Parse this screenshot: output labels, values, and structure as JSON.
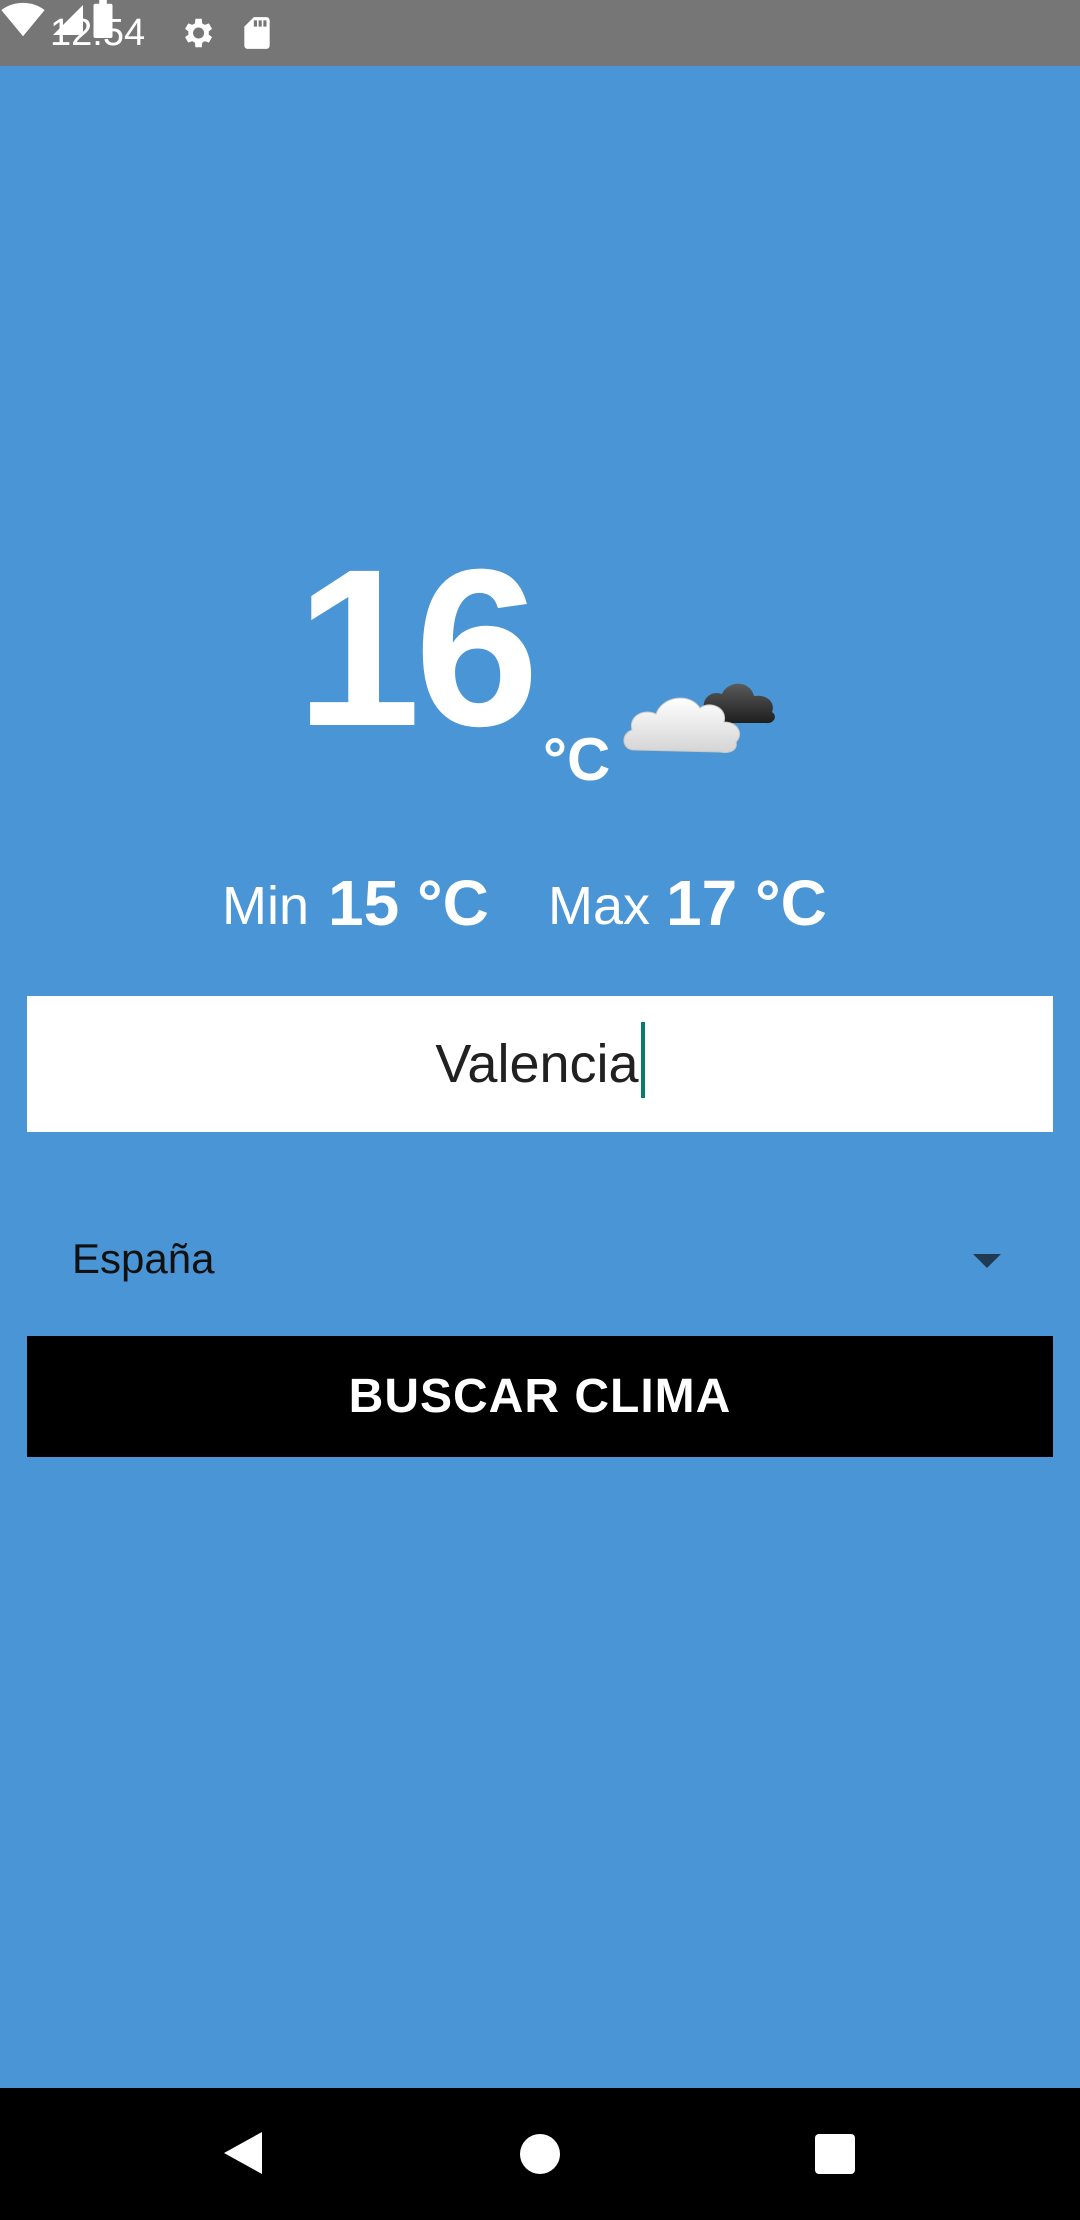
{
  "status_bar": {
    "time": "12:54",
    "icons": [
      "gear-icon",
      "sd-card-icon",
      "wifi-icon",
      "signal-icon",
      "battery-icon"
    ]
  },
  "weather": {
    "temperature": "16",
    "unit": "°C",
    "condition_icon": "partly-cloudy-icon",
    "min_label": "Min",
    "min_value": "15 °C",
    "max_label": "Max",
    "max_value": "17 °C"
  },
  "form": {
    "city_value": "Valencia",
    "country_value": "España",
    "button_label": "BUSCAR CLIMA"
  },
  "colors": {
    "background": "#4A95D5",
    "status_bar": "#767676",
    "button": "#000000",
    "caret": "#0B7A73"
  },
  "nav_bar": {
    "icons": [
      "back-icon",
      "home-icon",
      "recents-icon"
    ]
  }
}
